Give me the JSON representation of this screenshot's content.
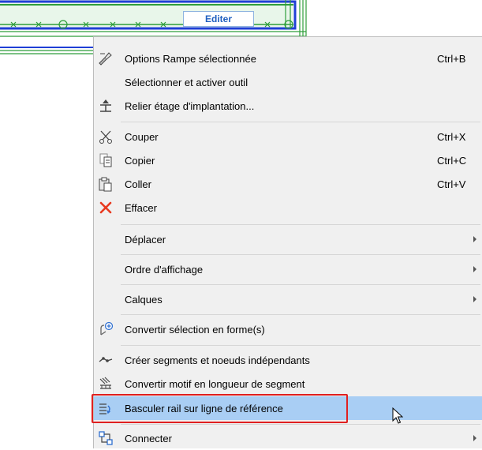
{
  "canvas": {
    "edit_label": "Editer"
  },
  "menu": {
    "items": [
      {
        "label": "Options Rampe sélectionnée",
        "shortcut": "Ctrl+B",
        "icon": "ramp-settings-icon"
      },
      {
        "label": "Sélectionner et activer outil",
        "shortcut": "",
        "icon": ""
      },
      {
        "label": "Relier étage d'implantation...",
        "shortcut": "",
        "icon": "link-story-icon"
      },
      {
        "label": "Couper",
        "shortcut": "Ctrl+X",
        "icon": "scissors-icon"
      },
      {
        "label": "Copier",
        "shortcut": "Ctrl+C",
        "icon": "copy-icon"
      },
      {
        "label": "Coller",
        "shortcut": "Ctrl+V",
        "icon": "paste-icon"
      },
      {
        "label": "Effacer",
        "shortcut": "",
        "icon": "delete-icon"
      },
      {
        "label": "Déplacer",
        "shortcut": "",
        "icon": "",
        "submenu": true
      },
      {
        "label": "Ordre d'affichage",
        "shortcut": "",
        "icon": "",
        "submenu": true
      },
      {
        "label": "Calques",
        "shortcut": "",
        "icon": "",
        "submenu": true
      },
      {
        "label": "Convertir sélection en forme(s)",
        "shortcut": "",
        "icon": "convert-shape-icon"
      },
      {
        "label": "Créer segments et noeuds indépendants",
        "shortcut": "",
        "icon": "segments-nodes-icon"
      },
      {
        "label": "Convertir motif en longueur de segment",
        "shortcut": "",
        "icon": "pattern-segment-icon"
      },
      {
        "label": "Basculer rail sur ligne de référence",
        "shortcut": "",
        "icon": "flip-rail-icon",
        "highlighted": true
      },
      {
        "label": "Connecter",
        "shortcut": "",
        "icon": "connect-icon",
        "submenu": true
      }
    ]
  },
  "colors": {
    "highlight": "#a9cef4",
    "annotation_box": "#e02020",
    "delete_icon": "#e8391f",
    "rail_green": "#2e9e3a",
    "selection_blue": "#1f3fd6"
  }
}
